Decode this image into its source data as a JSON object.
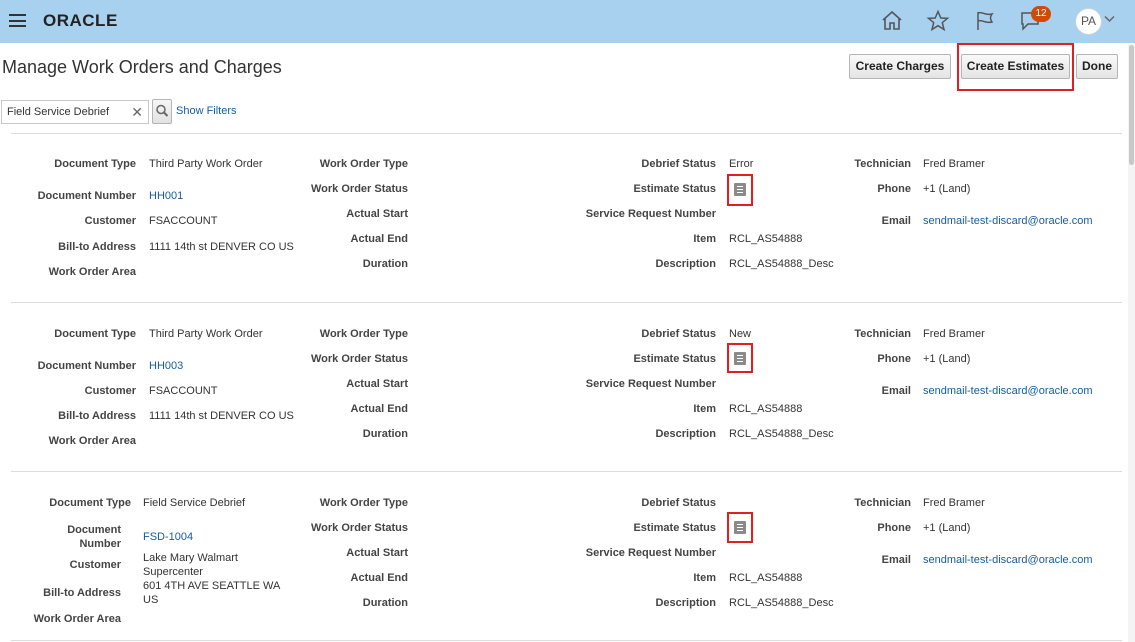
{
  "header": {
    "logo": "ORACLE",
    "notification_count": "12",
    "avatar_initials": "PA"
  },
  "page": {
    "title": "Manage Work Orders and Charges",
    "buttons": {
      "create_charges": "Create Charges",
      "create_estimates": "Create Estimates",
      "done": "Done"
    },
    "search": {
      "value": "Field Service Debrief",
      "show_filters": "Show Filters"
    }
  },
  "labels": {
    "document_type": "Document Type",
    "document_number": "Document Number",
    "customer": "Customer",
    "bill_to": "Bill-to Address",
    "work_order_area": "Work Order Area",
    "work_order_type": "Work Order Type",
    "work_order_status": "Work Order Status",
    "actual_start": "Actual Start",
    "actual_end": "Actual End",
    "duration": "Duration",
    "debrief_status": "Debrief Status",
    "estimate_status": "Estimate Status",
    "sr_number": "Service Request Number",
    "item": "Item",
    "description": "Description",
    "technician": "Technician",
    "phone": "Phone",
    "email": "Email",
    "document_number_line1": "Document",
    "document_number_line2": "Number"
  },
  "records": [
    {
      "document_type": "Third Party Work Order",
      "document_number": "HH001",
      "customer": "FSACCOUNT",
      "bill_to": "1111 14th st DENVER CO US",
      "debrief_status": "Error",
      "item": "RCL_AS54888",
      "description": "RCL_AS54888_Desc",
      "technician": "Fred Bramer",
      "phone": "+1 (Land)",
      "email": "sendmail-test-discard@oracle.com"
    },
    {
      "document_type": "Third Party Work Order",
      "document_number": "HH003",
      "customer": "FSACCOUNT",
      "bill_to": "1111 14th st DENVER CO US",
      "debrief_status": "New",
      "item": "RCL_AS54888",
      "description": "RCL_AS54888_Desc",
      "technician": "Fred Bramer",
      "phone": "+1 (Land)",
      "email": "sendmail-test-discard@oracle.com"
    },
    {
      "document_type": "Field Service Debrief",
      "document_number": "FSD-1004",
      "customer_line1": "Lake Mary Walmart",
      "customer_line2": "Supercenter",
      "bill_to_line1": "601 4TH AVE SEATTLE WA",
      "bill_to_line2": "US",
      "debrief_status": "",
      "item": "RCL_AS54888",
      "description": "RCL_AS54888_Desc",
      "technician": "Fred Bramer",
      "phone": "+1 (Land)",
      "email": "sendmail-test-discard@oracle.com"
    }
  ]
}
